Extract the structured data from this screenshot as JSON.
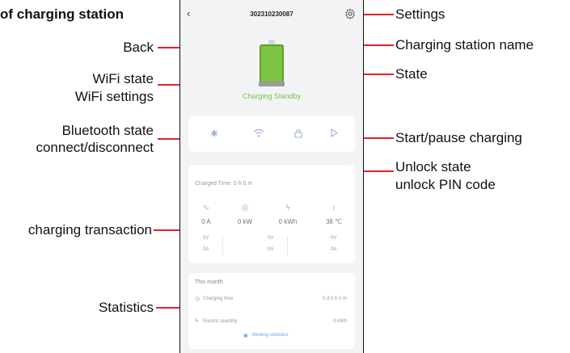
{
  "header": {
    "station_id": "302310230087"
  },
  "status": {
    "state_text": "Charging Standby",
    "battery_color": "#7bc442"
  },
  "controls": {
    "bluetooth_icon": "bluetooth-icon",
    "wifi_icon": "wifi-icon",
    "lock_icon": "lock-icon",
    "play_icon": "play-icon"
  },
  "transaction": {
    "charged_time": "Charged Time: 0 h 0 m",
    "current": "0 A",
    "power": "0 kW",
    "energy": "0 kWh",
    "temperature": "38 ℃",
    "voltages": [
      "0V",
      "0V",
      "0V"
    ],
    "currents": [
      "0A",
      "0A",
      "0A"
    ]
  },
  "statistics": {
    "period": "This month",
    "charging_time_label": "Charging time",
    "charging_time_value": "0 d 0 h 0 m",
    "electric_quantity_label": "Electric quantity",
    "electric_quantity_value": "0 kWh",
    "viewing_link": "Viewing statistics"
  },
  "annotations": {
    "page_title": "of charging station",
    "back": "Back",
    "wifi_line1": "WiFi state",
    "wifi_line2": "WiFi settings",
    "bt_line1": "Bluetooth state",
    "bt_line2": "connect/disconnect",
    "charging_transaction": "charging transaction",
    "statistics": "Statistics",
    "settings": "Settings",
    "station_name": "Charging station name",
    "state": "State",
    "start_pause": "Start/pause charging",
    "unlock_line1": "Unlock state",
    "unlock_line2": "unlock PIN code"
  },
  "colors": {
    "annotation_line": "#e0232a",
    "accent_blue": "#9db2d6",
    "state_green": "#7bc442"
  }
}
